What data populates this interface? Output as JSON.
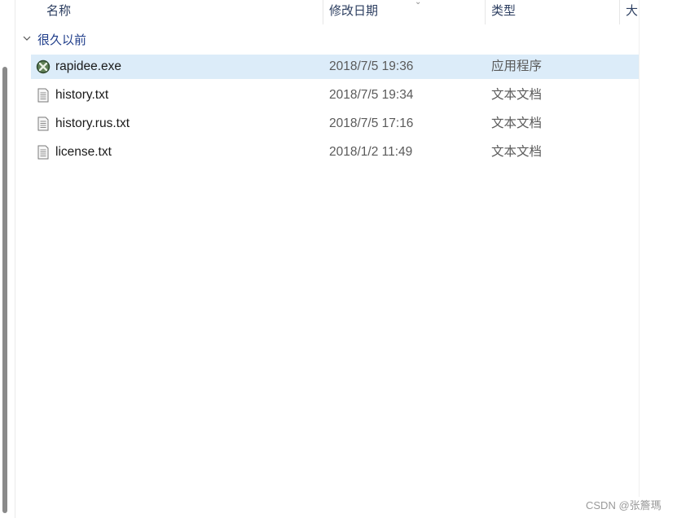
{
  "columns": {
    "name": "名称",
    "date": "修改日期",
    "type": "类型",
    "size": "大"
  },
  "group": {
    "label": "很久以前"
  },
  "files": [
    {
      "name": "rapidee.exe",
      "date": "2018/7/5 19:36",
      "type": "应用程序",
      "icon": "app-icon",
      "selected": true
    },
    {
      "name": "history.txt",
      "date": "2018/7/5 19:34",
      "type": "文本文档",
      "icon": "text-file-icon",
      "selected": false
    },
    {
      "name": "history.rus.txt",
      "date": "2018/7/5 17:16",
      "type": "文本文档",
      "icon": "text-file-icon",
      "selected": false
    },
    {
      "name": "license.txt",
      "date": "2018/1/2 11:49",
      "type": "文本文档",
      "icon": "text-file-icon",
      "selected": false
    }
  ],
  "watermark": "CSDN @张簷瑪"
}
